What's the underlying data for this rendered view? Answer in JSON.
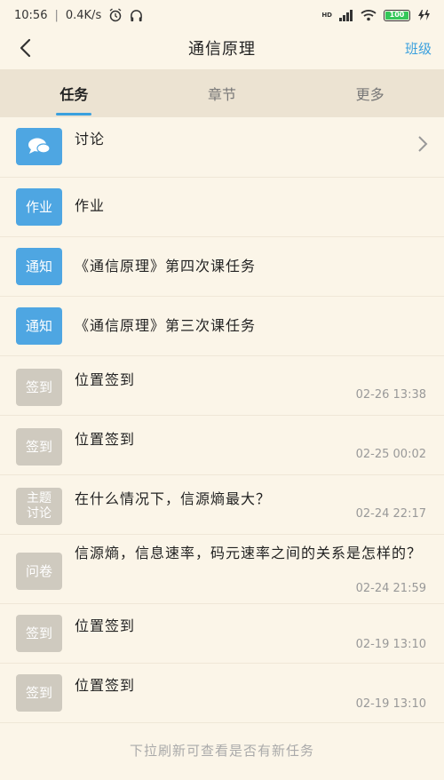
{
  "status": {
    "time": "10:56",
    "network_speed": "0.4K/s",
    "signal_label": "HD",
    "battery": "100"
  },
  "header": {
    "title": "通信原理",
    "action": "班级"
  },
  "tabs": [
    {
      "label": "任务",
      "active": true
    },
    {
      "label": "章节",
      "active": false
    },
    {
      "label": "更多",
      "active": false
    }
  ],
  "items": [
    {
      "badge": "",
      "badge_icon": "chat-bubbles-icon",
      "title": "讨论",
      "time": "",
      "color": "blue"
    },
    {
      "badge": "作业",
      "title": "作业",
      "time": "",
      "color": "blue"
    },
    {
      "badge": "通知",
      "title": "《通信原理》第四次课任务",
      "time": "",
      "color": "blue"
    },
    {
      "badge": "通知",
      "title": "《通信原理》第三次课任务",
      "time": "",
      "color": "blue"
    },
    {
      "badge": "签到",
      "title": "位置签到",
      "time": "02-26 13:38",
      "color": "gray"
    },
    {
      "badge": "签到",
      "title": "位置签到",
      "time": "02-25 00:02",
      "color": "gray"
    },
    {
      "badge": "主题\n讨论",
      "title": "在什么情况下，信源熵最大？",
      "time": "02-24 22:17",
      "color": "gray"
    },
    {
      "badge": "问卷",
      "title": "信源熵，信息速率，码元速率之间的关系是怎样的？",
      "time": "02-24 21:59",
      "color": "gray"
    },
    {
      "badge": "签到",
      "title": "位置签到",
      "time": "02-19 13:10",
      "color": "gray"
    },
    {
      "badge": "签到",
      "title": "位置签到",
      "time": "02-19 13:10",
      "color": "gray"
    }
  ],
  "footer_hint": "下拉刷新可查看是否有新任务",
  "colors": {
    "accent": "#3aa0de",
    "badge_blue": "#4ea6e2",
    "badge_gray": "#cfcabf",
    "background": "#fbf5e8",
    "tab_bar": "#ece3d2"
  }
}
